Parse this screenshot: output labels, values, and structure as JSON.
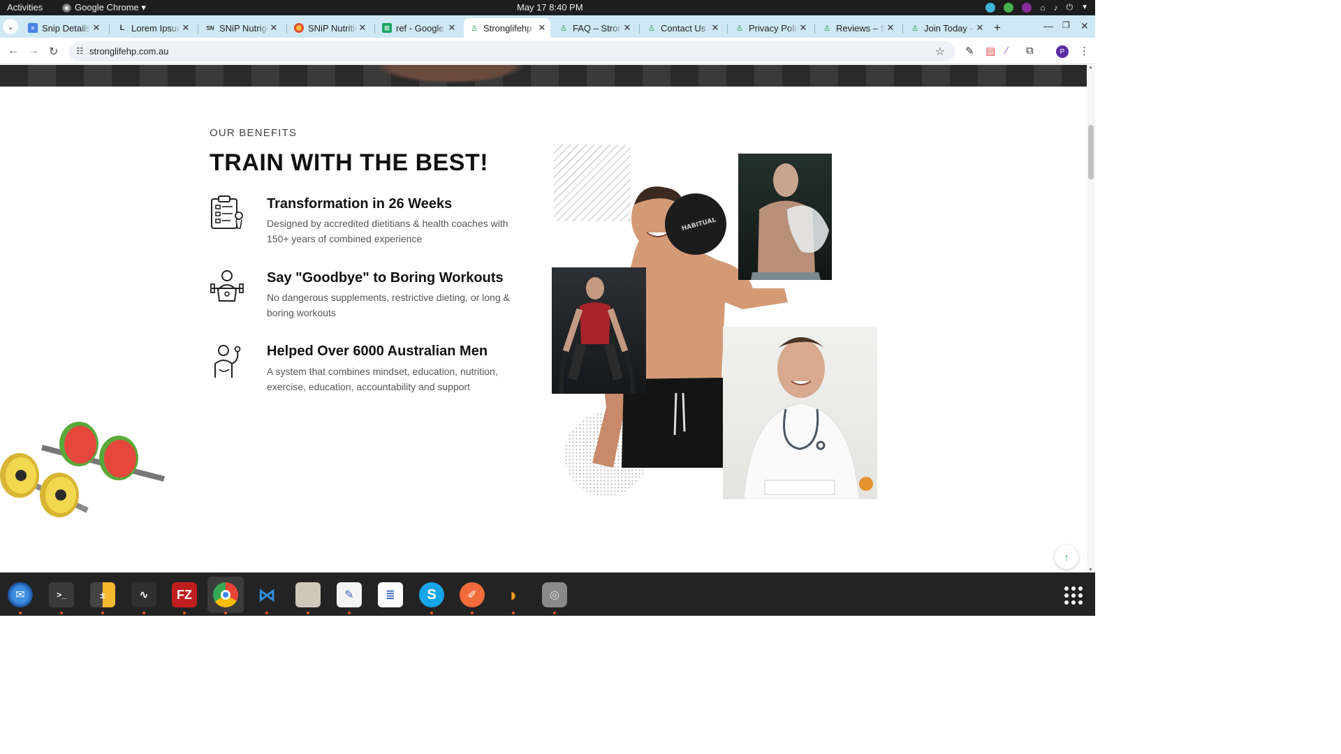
{
  "topbar": {
    "activities": "Activities",
    "app_name": "Google Chrome ▾",
    "clock": "May 17  8:40 PM"
  },
  "tabs": [
    {
      "title": "Snip Details",
      "favicon": "docs-icon"
    },
    {
      "title": "Lorem Ipsum",
      "favicon": "lorem-ipsum-icon"
    },
    {
      "title": "SNiP Nutrigenomics",
      "favicon": "snip-icon"
    },
    {
      "title": "SNiP Nutrition",
      "favicon": "fruit-icon"
    },
    {
      "title": "ref - Google Sheets",
      "favicon": "sheets-icon"
    },
    {
      "title": "Stronglifehp",
      "favicon": "stronglife-icon",
      "active": true
    },
    {
      "title": "FAQ – Stronglife",
      "favicon": "stronglife-icon"
    },
    {
      "title": "Contact Us – Stronglife",
      "favicon": "stronglife-icon"
    },
    {
      "title": "Privacy Policy",
      "favicon": "stronglife-icon"
    },
    {
      "title": "Reviews – Stronglife",
      "favicon": "stronglife-icon"
    },
    {
      "title": "Join Today – Stronglife",
      "favicon": "stronglife-icon"
    }
  ],
  "toolbar": {
    "url": "stronglifehp.com.au",
    "profile_initial": "P"
  },
  "page": {
    "eyebrow": "OUR BENEFITS",
    "headline": "TRAIN WITH THE BEST!",
    "benefits": [
      {
        "icon": "clipboard-plan-icon",
        "title": "Transformation in 26 Weeks",
        "description": "Designed by accredited dietitians & health coaches with 150+ years of combined experience"
      },
      {
        "icon": "athlete-dumbbell-icon",
        "title": "Say \"Goodbye\" to Boring Workouts",
        "description": "No dangerous supplements, restrictive dieting, or long & boring workouts"
      },
      {
        "icon": "strong-man-icon",
        "title": "Helped Over 6000 Australian Men",
        "description": "A system that combines mindset, education, nutrition, exercise, education, accountability and support"
      }
    ],
    "collage": {
      "ball_text": "HABITUAL"
    }
  },
  "dock": [
    "thunderbird-icon",
    "terminal-icon",
    "calculator-icon",
    "system-monitor-icon",
    "filezilla-icon",
    "chrome-icon",
    "vscode-icon",
    "files-icon",
    "text-editor-icon",
    "libreoffice-writer-icon",
    "skype-icon",
    "postman-icon",
    "app-flame-icon",
    "disk-icon"
  ],
  "colors": {
    "tab_strip": "#cfe8f5",
    "accent_green": "#2aa34a",
    "dock_bg": "#232323",
    "topbar_bg": "#1d1d1d"
  }
}
